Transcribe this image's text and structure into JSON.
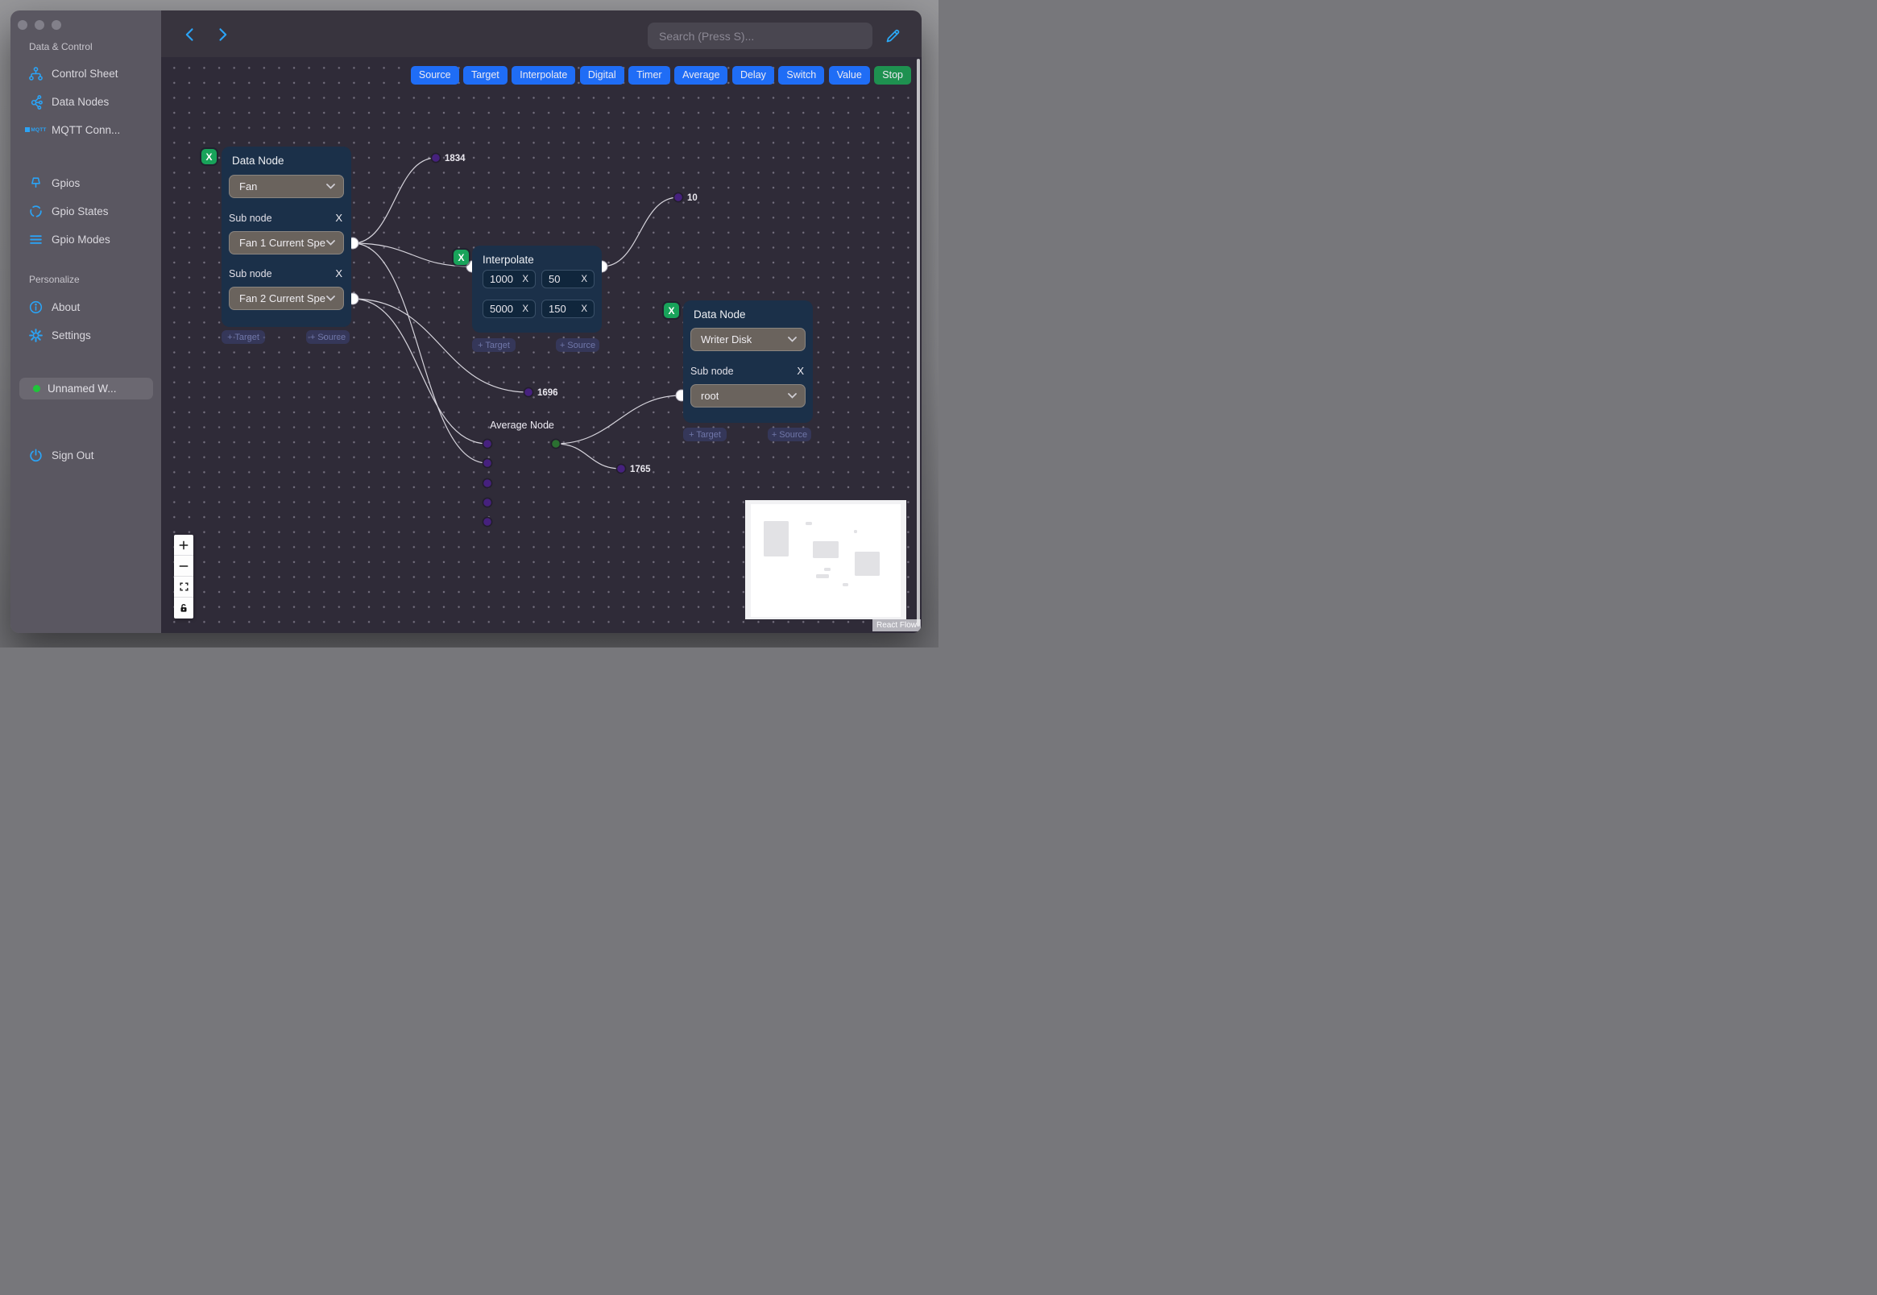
{
  "colors": {
    "accent_blue": "#2ba3f5",
    "button_blue": "#1f6df6",
    "button_green": "#1e9150",
    "node_bg": "#1b3049",
    "canvas_bg": "#2f2b38",
    "sidebar_bg": "#5a5761",
    "purple_port": "#46217e",
    "green_port": "#2b7031",
    "delete_green": "#18a35a"
  },
  "sidebar": {
    "section1_heading": "Data & Control",
    "items": [
      {
        "label": "Control Sheet"
      },
      {
        "label": "Data Nodes"
      },
      {
        "label": "MQTT Conn..."
      },
      {
        "label": "Gpios"
      },
      {
        "label": "Gpio States"
      },
      {
        "label": "Gpio Modes"
      }
    ],
    "section2_heading": "Personalize",
    "about": "About",
    "settings": "Settings",
    "workflow": "Unnamed W...",
    "sign_out": "Sign Out",
    "mqtt_icon_text": "MQTT"
  },
  "topbar": {
    "search_placeholder": "Search (Press S)..."
  },
  "toolbar": {
    "items": [
      {
        "label": "Source"
      },
      {
        "label": "Target"
      },
      {
        "label": "Interpolate"
      },
      {
        "label": "Digital"
      },
      {
        "label": "Timer"
      },
      {
        "label": "Average"
      },
      {
        "label": "Delay"
      },
      {
        "label": "Switch"
      },
      {
        "label": "Value"
      },
      {
        "label": "Stop"
      }
    ]
  },
  "flow": {
    "chips": {
      "target": "+ Target",
      "source": "+ Source"
    },
    "delete_label": "X",
    "remove_label": "X",
    "fan_node": {
      "title": "Data Node",
      "type_value": "Fan",
      "sub_label": "Sub node",
      "sub_value_1": "Fan 1 Current Spe",
      "sub_value_2": "Fan 2 Current Spe"
    },
    "interpolate_node": {
      "title": "Interpolate",
      "pairs": [
        [
          "1000",
          "50"
        ],
        [
          "5000",
          "150"
        ]
      ]
    },
    "writer_node": {
      "title": "Data Node",
      "type_value": "Writer Disk",
      "sub_label": "Sub node",
      "sub_value": "root"
    },
    "average_node": {
      "title": "Average Node"
    },
    "edge_labels": {
      "l1834": "1834",
      "l10": "10",
      "l1696": "1696",
      "l1765": "1765"
    }
  },
  "attribution": "React Flow"
}
